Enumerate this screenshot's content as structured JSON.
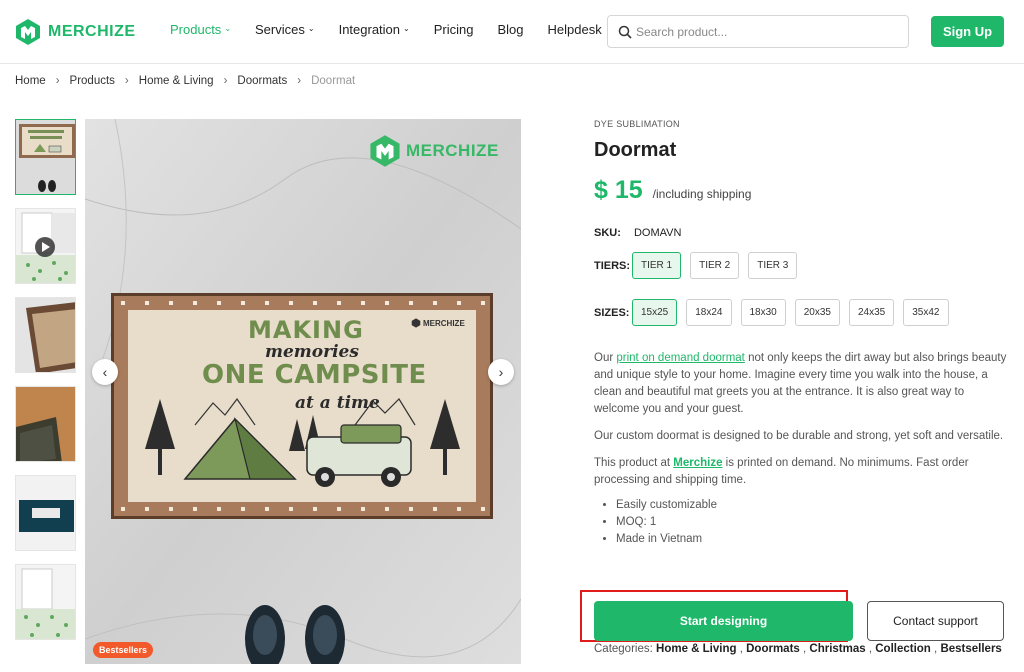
{
  "brand": {
    "name": "MERCHIZE",
    "color": "#1fb86a"
  },
  "nav": [
    {
      "label": "Products",
      "dropdown": true,
      "active": true
    },
    {
      "label": "Services",
      "dropdown": true,
      "active": false
    },
    {
      "label": "Integration",
      "dropdown": true,
      "active": false
    },
    {
      "label": "Pricing",
      "dropdown": false,
      "active": false
    },
    {
      "label": "Blog",
      "dropdown": false,
      "active": false
    },
    {
      "label": "Helpdesk",
      "dropdown": false,
      "active": false
    }
  ],
  "search": {
    "placeholder": "Search product..."
  },
  "signup_label": "Sign Up",
  "breadcrumb": [
    "Home",
    "Products",
    "Home & Living",
    "Doormats",
    "Doormat"
  ],
  "gallery": {
    "badge": "Bestsellers",
    "watermark": "MERCHIZE",
    "mat_text": [
      "MAKING",
      "memories",
      "ONE CAMPSITE",
      "at a time"
    ],
    "mat_logo": "MERCHIZE"
  },
  "product": {
    "eyebrow": "DYE SUBLIMATION",
    "title": "Doormat",
    "price": "$ 15",
    "price_note": "/including shipping",
    "sku_label": "SKU:",
    "sku": "DOMAVN",
    "tiers_label": "TIERS:",
    "tiers": [
      "TIER 1",
      "TIER 2",
      "TIER 3"
    ],
    "sizes_label": "SIZES:",
    "sizes": [
      "15x25",
      "18x24",
      "18x30",
      "20x35",
      "24x35",
      "35x42"
    ],
    "desc1_pre": "Our ",
    "desc1_link": "print on demand doormat",
    "desc1_post": " not only keeps the dirt away but also brings beauty and unique style to your home. Imagine every time you walk into the house, a clean and beautiful mat greets you at the entrance. It is also  great way to welcome you and your guest.",
    "desc2": "Our custom doormat is designed to be durable and strong, yet soft and versatile.",
    "desc3_pre": "This product at ",
    "desc3_link": "Merchize",
    "desc3_post": " is printed on demand. No minimums. Fast order processing and shipping time.",
    "bullets": [
      "Easily customizable",
      "MOQ: 1",
      "Made in Vietnam"
    ],
    "start_label": "Start designing",
    "contact_label": "Contact support",
    "categories_label": "Categories:",
    "categories": [
      "Home & Living",
      "Doormats",
      "Christmas",
      "Collection",
      "Bestsellers"
    ]
  }
}
